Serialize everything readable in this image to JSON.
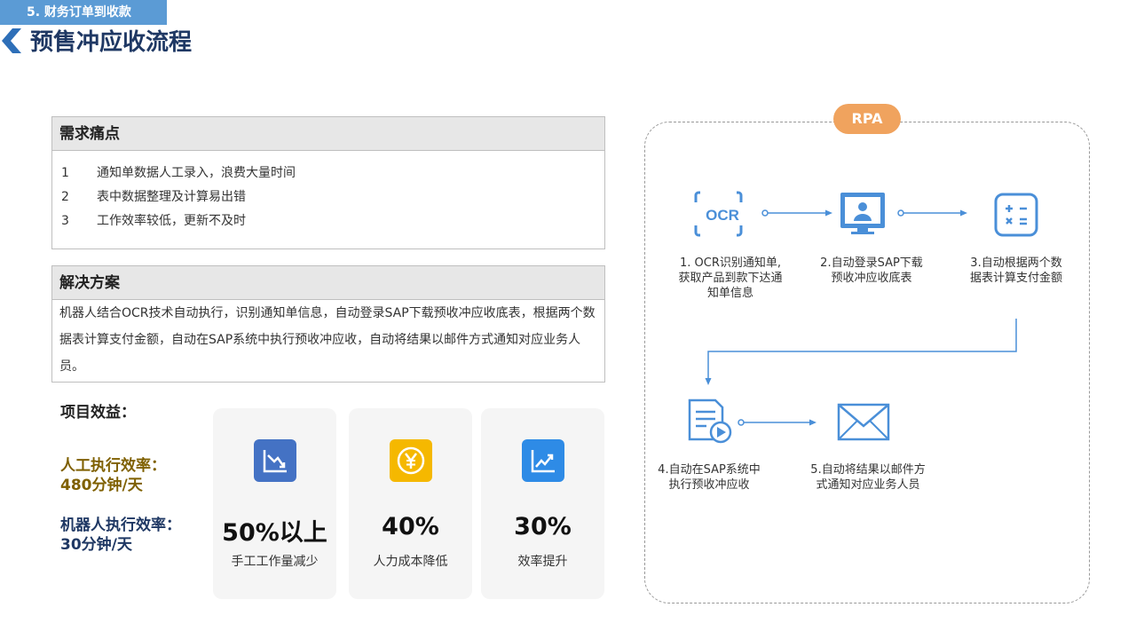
{
  "header": {
    "section_tag": "5. 财务订单到收款",
    "title": "预售冲应收流程"
  },
  "pain_points": {
    "heading": "需求痛点",
    "items": [
      {
        "num": "1",
        "text": "通知单数据人工录入，浪费大量时间"
      },
      {
        "num": "2",
        "text": "表中数据整理及计算易出错"
      },
      {
        "num": "3",
        "text": "工作效率较低，更新不及时"
      }
    ]
  },
  "solution": {
    "heading": "解决方案",
    "text": "机器人结合OCR技术自动执行，识别通知单信息，自动登录SAP下载预收冲应收底表，根据两个数据表计算支付金额，自动在SAP系统中执行预收冲应收，自动将结果以邮件方式通知对应业务人员。"
  },
  "benefits": {
    "heading": "项目效益：",
    "manual_rate_label": "人工执行效率：",
    "manual_rate_value": "480分钟/天",
    "robot_rate_label": "机器人执行效率：",
    "robot_rate_value": "30分钟/天",
    "cards": [
      {
        "value": "50%以上",
        "label": "手工工作量减少",
        "icon": "chart-down-icon",
        "color": "#4472c4"
      },
      {
        "value": "40%",
        "label": "人力成本降低",
        "icon": "yen-coin-icon",
        "color": "#f5b800"
      },
      {
        "value": "30%",
        "label": "效率提升",
        "icon": "chart-up-icon",
        "color": "#2e8be6"
      }
    ]
  },
  "rpa": {
    "badge": "RPA",
    "badge_color": "#f0a35e",
    "accent_color": "#5b9bd5",
    "steps": [
      {
        "icon": "ocr-icon",
        "line1": "1. OCR识别通知单,",
        "line2": "获取产品到款下达通",
        "line3": "知单信息"
      },
      {
        "icon": "monitor-user-icon",
        "line1": "2.自动登录SAP下载",
        "line2": "预收冲应收底表"
      },
      {
        "icon": "calculator-icon",
        "line1": "3.自动根据两个数",
        "line2": "据表计算支付金额"
      },
      {
        "icon": "document-play-icon",
        "line1": "4.自动在SAP系统中",
        "line2": "执行预收冲应收"
      },
      {
        "icon": "mail-icon",
        "line1": "5.自动将结果以邮件方",
        "line2": "式通知对应业务人员"
      }
    ]
  }
}
